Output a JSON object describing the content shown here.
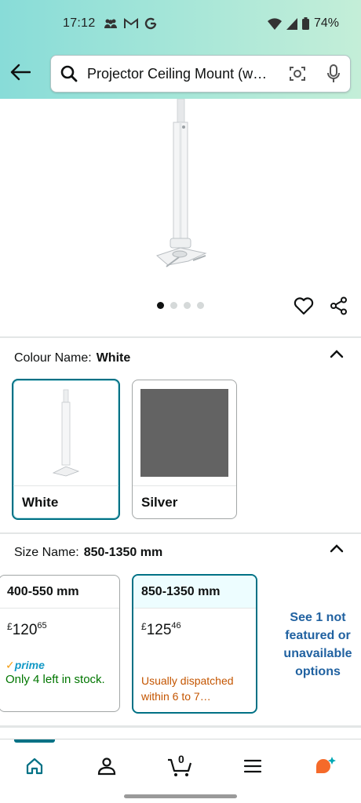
{
  "status": {
    "time": "17:12",
    "battery": "74%"
  },
  "search": {
    "query": "Projector Ceiling Mount (w…"
  },
  "gallery": {
    "image_count": 4,
    "active_index": 0
  },
  "colour": {
    "label": "Colour Name:",
    "selected": "White",
    "options": [
      {
        "name": "White",
        "selected": true
      },
      {
        "name": "Silver",
        "selected": false
      }
    ]
  },
  "size": {
    "label": "Size Name:",
    "selected": "850-1350 mm",
    "options": [
      {
        "name": "400-550 mm",
        "currency": "£",
        "price_whole": "120",
        "price_frac": "65",
        "prime": "prime",
        "availability": "Only 4 left in stock.",
        "selected": false
      },
      {
        "name": "850-1350 mm",
        "currency": "£",
        "price_whole": "125",
        "price_frac": "46",
        "availability": "Usually dispatched within 6 to 7…",
        "selected": true
      }
    ],
    "see_more": "See 1 not featured or unavailable options"
  },
  "nav": {
    "cart_count": "0",
    "items": [
      "home-icon",
      "account-icon",
      "cart-icon",
      "menu-icon",
      "rufus-icon"
    ]
  },
  "colors": {
    "accent": "#007185",
    "link": "#2162a1",
    "stock_green": "#007600",
    "stock_orange": "#c45500",
    "rufus": "#f56a2a"
  }
}
